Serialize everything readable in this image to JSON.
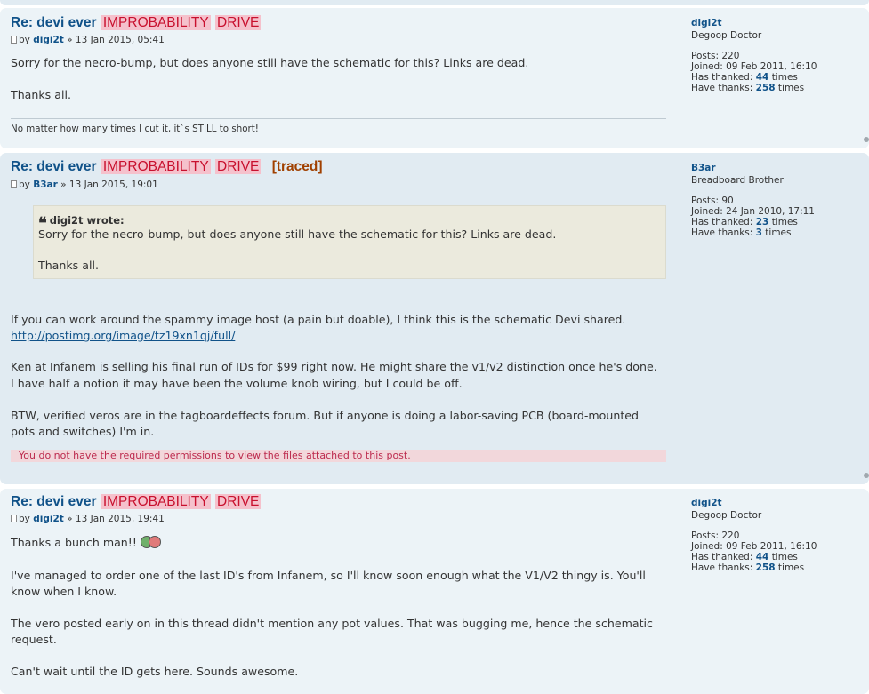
{
  "posts": [
    {
      "title": {
        "prefix": "Re: devi ever",
        "hl1": "IMPROBABILITY",
        "hl2": "DRIVE",
        "tag": ""
      },
      "author": {
        "by": "by",
        "name": "digi2t",
        "date": "» 13 Jan 2015, 05:41"
      },
      "lines": [
        "Sorry for the necro-bump, but does anyone still have the schematic for this? Links are dead.",
        "Thanks all."
      ],
      "signature": "No matter how many times I cut it, it`s STILL to short!",
      "profile": {
        "name": "digi2t",
        "rank": "Degoop Doctor",
        "posts_label": "Posts:",
        "posts": "220",
        "joined_label": "Joined:",
        "joined": "09 Feb 2011, 16:10",
        "thanked_label": "Has thanked:",
        "thanked": "44",
        "thanks_label": "Have thanks:",
        "thanks": "258",
        "times": "times"
      }
    },
    {
      "title": {
        "prefix": "Re: devi ever",
        "hl1": "IMPROBABILITY",
        "hl2": "DRIVE",
        "tag": "[traced]"
      },
      "author": {
        "by": "by",
        "name": "B3ar",
        "date": "» 13 Jan 2015, 19:01"
      },
      "quote": {
        "cite": "digi2t wrote:",
        "lines": [
          "Sorry for the necro-bump, but does anyone still have the schematic for this? Links are dead.",
          "Thanks all."
        ]
      },
      "lines": [
        "If you can work around the spammy image host (a pain but doable), I think this is the schematic Devi shared.",
        "http://postimg.org/image/tz19xn1qj/full/",
        "Ken at Infanem is selling his final run of IDs for $99 right now. He might share the v1/v2 distinction once he's done.",
        "I have half a notion it may have been the volume knob wiring, but I could be off.",
        "BTW, verified veros are in the tagboardeffects forum. But if anyone is doing a labor-saving PCB (board-mounted",
        "pots and switches) I'm in."
      ],
      "notice": "You do not have the required permissions to view the files attached to this post.",
      "profile": {
        "name": "B3ar",
        "rank": "Breadboard Brother",
        "posts_label": "Posts:",
        "posts": "90",
        "joined_label": "Joined:",
        "joined": "24 Jan 2010, 17:11",
        "thanked_label": "Has thanked:",
        "thanked": "23",
        "thanks_label": "Have thanks:",
        "thanks": "3",
        "times": "times"
      }
    },
    {
      "title": {
        "prefix": "Re: devi ever",
        "hl1": "IMPROBABILITY",
        "hl2": "DRIVE",
        "tag": ""
      },
      "author": {
        "by": "by",
        "name": "digi2t",
        "date": "» 13 Jan 2015, 19:41"
      },
      "lines": [
        "Thanks a bunch man!!",
        "I've managed to order one of the last ID's from Infanem, so I'll know soon enough what the V1/V2 thingy is. You'll",
        "know when I know.",
        "The vero posted early on in this thread didn't mention any pot values. That was bugging me, hence the schematic",
        "request.",
        "Can't wait until the ID gets here. Sounds awesome."
      ],
      "profile": {
        "name": "digi2t",
        "rank": "Degoop Doctor",
        "posts_label": "Posts:",
        "posts": "220",
        "joined_label": "Joined:",
        "joined": "09 Feb 2011, 16:10",
        "thanked_label": "Has thanked:",
        "thanked": "44",
        "thanks_label": "Have thanks:",
        "thanks": "258",
        "times": "times"
      }
    }
  ],
  "colors": {
    "post_bg_1": "#ecf3f7",
    "post_bg_2": "#e1ebf2",
    "highlight_bg": "#f5c1cc",
    "highlight_text": "#c8102e",
    "link": "#105289",
    "quote_bg": "#ebeadd",
    "notice_bg": "#f2d7db",
    "notice_text": "#bc2a4d"
  }
}
